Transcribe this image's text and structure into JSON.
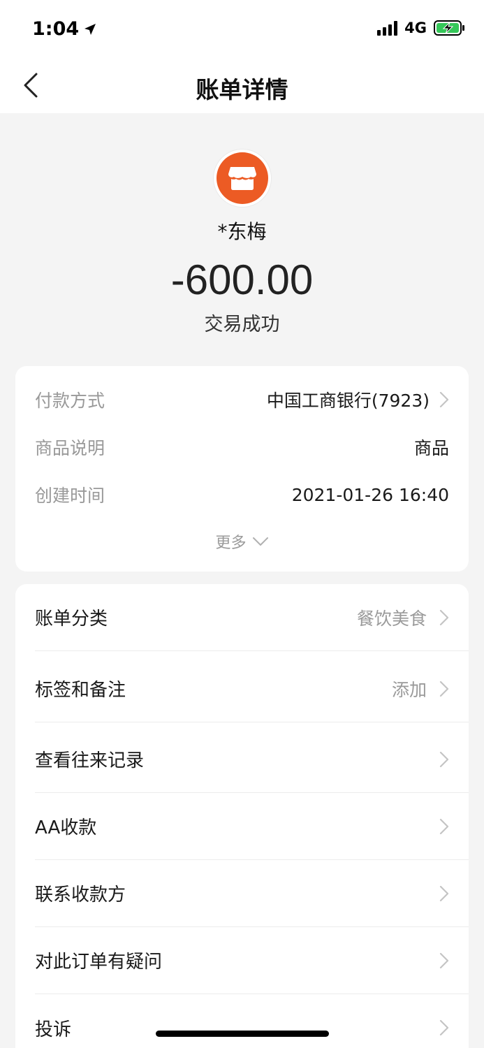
{
  "status_bar": {
    "time": "1:04",
    "network": "4G"
  },
  "nav": {
    "title": "账单详情"
  },
  "merchant": {
    "name": "*东梅",
    "amount": "-600.00",
    "status": "交易成功",
    "icon": "store-icon",
    "icon_color": "#ec5b24"
  },
  "info": {
    "rows": [
      {
        "label": "付款方式",
        "value": "中国工商银行(7923)"
      },
      {
        "label": "商品说明",
        "value": "商品"
      },
      {
        "label": "创建时间",
        "value": "2021-01-26 16:40"
      }
    ],
    "more_label": "更多"
  },
  "actions": [
    {
      "label": "账单分类",
      "value": "餐饮美食"
    },
    {
      "label": "标签和备注",
      "value": "添加"
    },
    {
      "label": "查看往来记录",
      "value": ""
    },
    {
      "label": "AA收款",
      "value": ""
    },
    {
      "label": "联系收款方",
      "value": ""
    },
    {
      "label": "对此订单有疑问",
      "value": ""
    },
    {
      "label": "投诉",
      "value": ""
    }
  ]
}
